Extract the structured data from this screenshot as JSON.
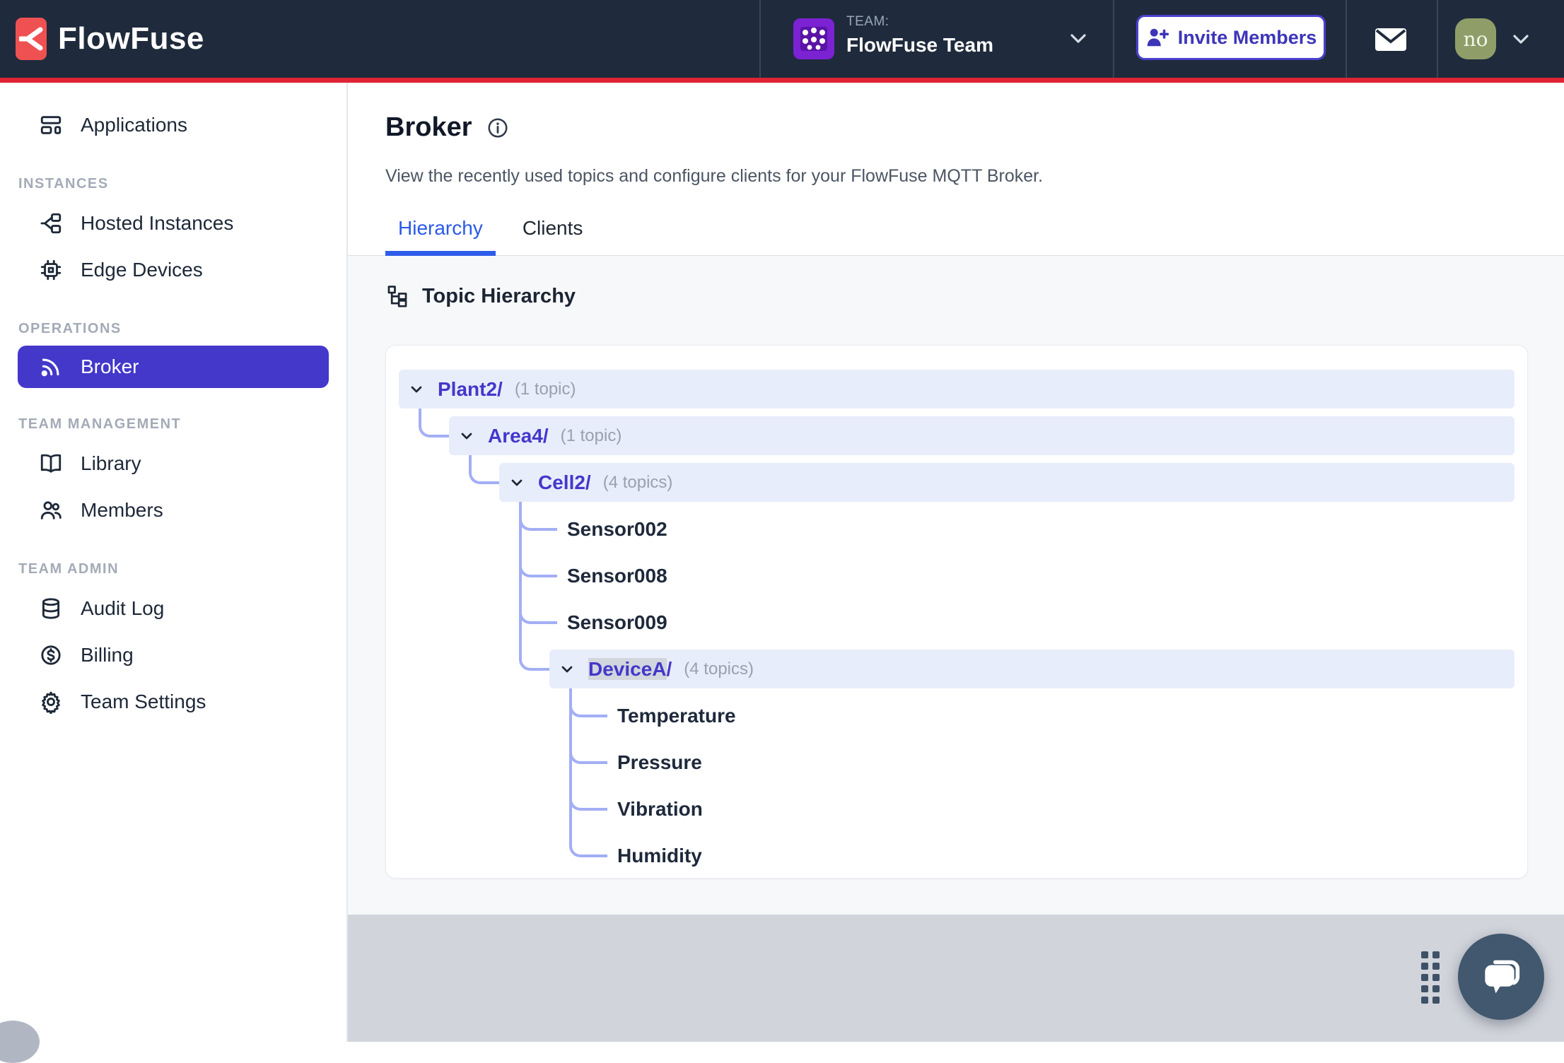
{
  "navbar": {
    "brand": "FlowFuse",
    "team_label": "TEAM:",
    "team_name": "FlowFuse Team",
    "invite_button": "Invite Members",
    "user_initials": "no"
  },
  "sidebar": {
    "top_item": {
      "label": "Applications"
    },
    "sections": [
      {
        "header": "INSTANCES",
        "items": [
          {
            "label": "Hosted Instances"
          },
          {
            "label": "Edge Devices"
          }
        ]
      },
      {
        "header": "OPERATIONS",
        "items": [
          {
            "label": "Broker",
            "active": true
          }
        ]
      },
      {
        "header": "TEAM MANAGEMENT",
        "items": [
          {
            "label": "Library"
          },
          {
            "label": "Members"
          }
        ]
      },
      {
        "header": "TEAM ADMIN",
        "items": [
          {
            "label": "Audit Log"
          },
          {
            "label": "Billing"
          },
          {
            "label": "Team Settings"
          }
        ]
      }
    ]
  },
  "page": {
    "title": "Broker",
    "description": "View the recently used topics and configure clients for your FlowFuse MQTT Broker.",
    "tabs": [
      {
        "label": "Hierarchy",
        "active": true
      },
      {
        "label": "Clients",
        "active": false
      }
    ]
  },
  "panel": {
    "heading": "Topic Hierarchy"
  },
  "tree": {
    "nodes": [
      {
        "label": "Plant2/",
        "count": "(1 topic)",
        "children": [
          {
            "label": "Area4/",
            "count": "(1 topic)",
            "children": [
              {
                "label": "Cell2/",
                "count": "(4 topics)",
                "children": [
                  {
                    "label": "Sensor002"
                  },
                  {
                    "label": "Sensor008"
                  },
                  {
                    "label": "Sensor009"
                  },
                  {
                    "label": "DeviceA/",
                    "count": "(4 topics)",
                    "selected_text": "DeviceA",
                    "children": [
                      {
                        "label": "Temperature"
                      },
                      {
                        "label": "Pressure"
                      },
                      {
                        "label": "Vibration"
                      },
                      {
                        "label": "Humidity"
                      }
                    ]
                  }
                ]
              }
            ]
          }
        ]
      }
    ]
  },
  "icons": {
    "brand": "fork-merge-icon",
    "broker": "rss-icon",
    "chat": "chat-bubbles-icon",
    "mail": "envelope-icon"
  },
  "colors": {
    "navbar_bg": "#1f2b3c",
    "accent_red": "#df2433",
    "logo_red": "#ef5152",
    "active_indigo": "#4338ca",
    "tab_blue": "#2c5cea",
    "tree_row_bg": "#e8edfb",
    "connector": "#a3aef5",
    "footer_gray": "#d1d4db",
    "chat_button": "#41586e",
    "user_avatar_green": "#8f9e68",
    "team_avatar_purple": "#7b22d3",
    "selection_gray": "#d2d6dd"
  }
}
